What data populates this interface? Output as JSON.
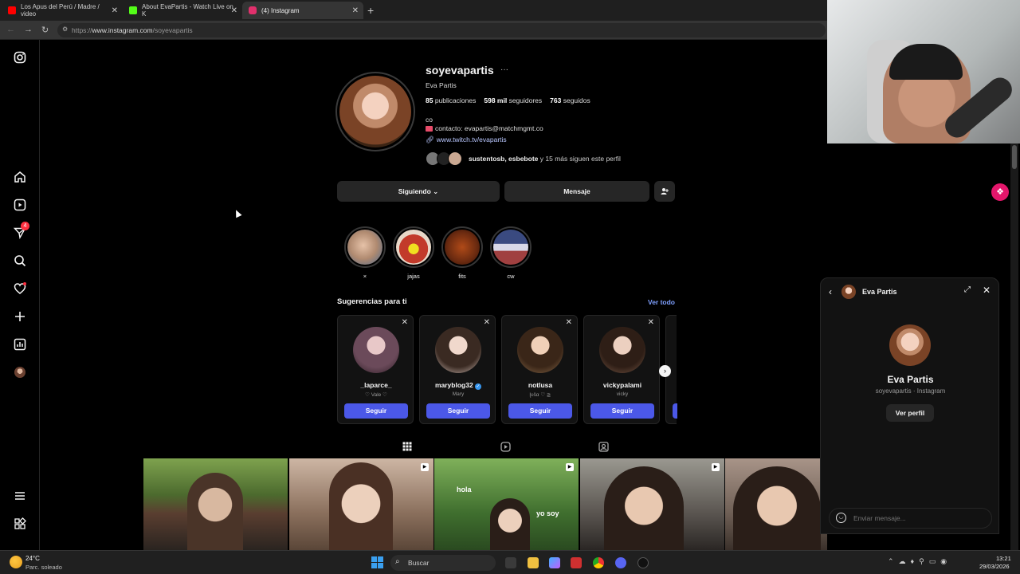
{
  "browser": {
    "tabs": [
      {
        "label": "Los Apus del Perú / Madre / video",
        "favicon_color": "#ff0000",
        "active": false
      },
      {
        "label": "About EvaPartis - Watch Live on K",
        "favicon_color": "#53fc18",
        "active": false
      },
      {
        "label": "(4) Instagram",
        "favicon_color": "#e1306c",
        "active": true
      }
    ],
    "url_prefix": "https://",
    "url_host": "www.instagram.com",
    "url_path": "/soyevapartis"
  },
  "sidebar": {
    "notification_badge": "4"
  },
  "profile": {
    "username": "soyevapartis",
    "more_glyph": "···",
    "full_name": "Eva Partis",
    "stats": {
      "posts_value": "85",
      "posts_label": "publicaciones",
      "followers_value": "598 mil",
      "followers_label": "seguidores",
      "following_value": "763",
      "following_label": "seguidos"
    },
    "bio_line1": "co",
    "bio_line2": "contacto: evapartis@matchmgmt.co",
    "bio_link": "www.twitch.tv/evapartis",
    "mutual_names": "sustentosb, esbebote",
    "mutual_rest": "y 15 más siguen este perfil"
  },
  "actions": {
    "following_label": "Siguiendo",
    "message_label": "Mensaje"
  },
  "highlights": [
    {
      "label": "×",
      "color": "#b08a70"
    },
    {
      "label": "jajas",
      "color": "#c23a2a"
    },
    {
      "label": "fits",
      "color": "#6a2a10"
    },
    {
      "label": "cw",
      "color": "#5a6aa0"
    }
  ],
  "suggestions": {
    "title": "Sugerencias para ti",
    "see_all": "Ver todo",
    "cards": [
      {
        "name": "_laparce_",
        "sub": "♡ Vale ♡",
        "button": "Seguir",
        "color": "#6b4a5a",
        "verified": false
      },
      {
        "name": "maryblog32",
        "sub": "Mary",
        "button": "Seguir",
        "color": "#d7c4bc",
        "verified": true
      },
      {
        "name": "notlusa",
        "sub": "ɭυšα ♡ ≧",
        "button": "Seguir",
        "color": "#8a6a4a",
        "verified": false
      },
      {
        "name": "vickypalami",
        "sub": "vicky",
        "button": "Seguir",
        "color": "#7a5a48",
        "verified": false
      }
    ]
  },
  "posts": [
    {
      "overlay_top": "",
      "overlay_bottom": "",
      "color": "#5c7a3a"
    },
    {
      "overlay_top": "",
      "overlay_bottom": "",
      "color": "#8a6f5c"
    },
    {
      "overlay_top": "hola",
      "overlay_bottom": "yo soy",
      "color": "#3f6e2e"
    },
    {
      "overlay_top": "",
      "overlay_bottom": "",
      "color": "#5a5550"
    },
    {
      "overlay_top": "",
      "overlay_bottom": "",
      "color": "#6e5f55"
    }
  ],
  "chat": {
    "header_name": "Eva Partis",
    "display_name": "Eva Partis",
    "subtitle": "soyevapartis · Instagram",
    "view_profile": "Ver perfil",
    "placeholder": "Enviar mensaje..."
  },
  "taskbar": {
    "weather_temp": "24°C",
    "weather_desc": "Parc. soleado",
    "search_label": "Buscar",
    "time": "13:21",
    "date": "29/03/2026"
  }
}
